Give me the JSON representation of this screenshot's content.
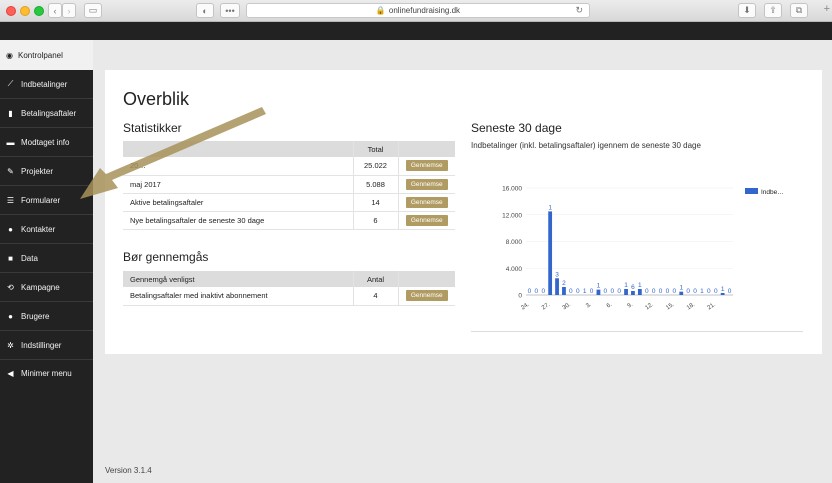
{
  "browser": {
    "url": "onlinefundraising.dk"
  },
  "sidebar": {
    "top_item": "Kontrolpanel",
    "items": [
      {
        "label": "Indbetalinger",
        "icon": "chart-line-icon"
      },
      {
        "label": "Betalingsaftaler",
        "icon": "bar-chart-icon"
      },
      {
        "label": "Modtaget info",
        "icon": "comment-icon"
      },
      {
        "label": "Projekter",
        "icon": "wrench-icon"
      },
      {
        "label": "Formularer",
        "icon": "list-icon"
      },
      {
        "label": "Kontakter",
        "icon": "users-icon"
      },
      {
        "label": "Data",
        "icon": "folder-icon"
      },
      {
        "label": "Kampagne",
        "icon": "refresh-icon"
      },
      {
        "label": "Brugere",
        "icon": "user-icon"
      },
      {
        "label": "Indstillinger",
        "icon": "gear-icon"
      },
      {
        "label": "Minimer menu",
        "icon": "circle-arrow-icon"
      }
    ]
  },
  "main": {
    "title": "Overblik",
    "statistikker": {
      "heading": "Statistikker",
      "col_total": "Total",
      "rows": [
        {
          "label": "20…",
          "value": "25.022",
          "button": "Gennemse"
        },
        {
          "label": "maj 2017",
          "value": "5.088",
          "button": "Gennemse"
        },
        {
          "label": "Aktive betalingsaftaler",
          "value": "14",
          "button": "Gennemse"
        },
        {
          "label": "Nye betalingsaftaler de seneste 30 dage",
          "value": "6",
          "button": "Gennemse"
        }
      ]
    },
    "bor": {
      "heading": "Bør gennemgås",
      "col_label": "Gennemgå venligst",
      "col_antal": "Antal",
      "rows": [
        {
          "label": "Betalingsaftaler med inaktivt abonnement",
          "value": "4",
          "button": "Gennemse"
        }
      ]
    },
    "seneste": {
      "heading": "Seneste 30 dage",
      "subtitle": "Indbetalinger (inkl. betalingsaftaler) igennem de seneste 30 dage"
    }
  },
  "footer": {
    "version": "Version 3.1.4"
  },
  "colors": {
    "bar": "#3366cc",
    "button": "#b09b62",
    "sidebar": "#222222",
    "arrow": "#a8925a"
  },
  "chart_data": {
    "type": "bar",
    "title": "",
    "legend": "Indbe…",
    "legend_position": "right",
    "ylim": [
      0,
      16000
    ],
    "yticks": [
      "16.000",
      "12.000",
      "8.000",
      "4.000",
      "0"
    ],
    "xticks": [
      "24.",
      "27.",
      "30.",
      "3.",
      "6.",
      "9.",
      "12.",
      "15.",
      "18.",
      "21."
    ],
    "values": [
      0,
      0,
      0,
      12500,
      2500,
      1200,
      0,
      0,
      0,
      0,
      800,
      0,
      0,
      0,
      900,
      600,
      900,
      0,
      0,
      0,
      0,
      0,
      500,
      0,
      0,
      0,
      0,
      0,
      300,
      0
    ],
    "labels": [
      "0",
      "0",
      "0",
      "1",
      "3",
      "2",
      "0",
      "0",
      "1",
      "0",
      "1",
      "0",
      "0",
      "0",
      "1",
      "6",
      "1",
      "0",
      "0",
      "0",
      "0",
      "0",
      "1",
      "0",
      "0",
      "1",
      "0",
      "0",
      "1",
      "0"
    ]
  }
}
